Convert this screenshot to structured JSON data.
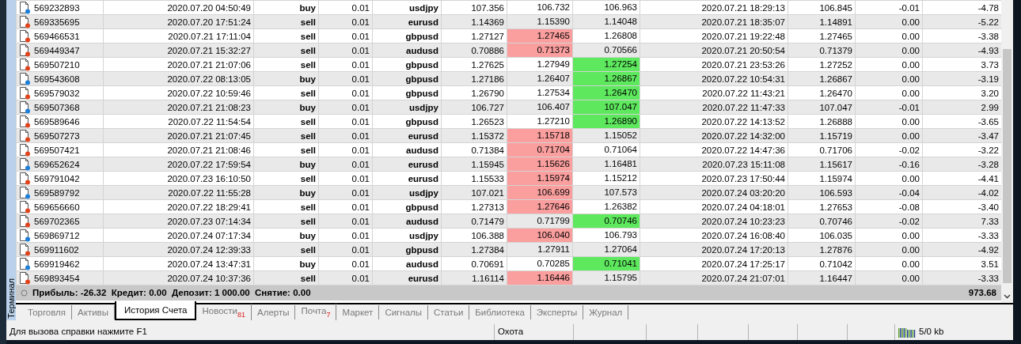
{
  "side_tab": "Терминал",
  "rows": [
    {
      "kind": "buy",
      "ticket": "569232893",
      "open_time": "2020.07.20 04:50:49",
      "type": "buy",
      "size": "0.01",
      "symbol": "usdjpy",
      "price": "107.356",
      "sl": "106.732",
      "tp": "106.963",
      "close_time": "2020.07.21 18:29:13",
      "close_price": "106.845",
      "swap": "-0.01",
      "profit": "-4.78",
      "sl_hit": false,
      "tp_hit": false
    },
    {
      "kind": "sell",
      "ticket": "569335695",
      "open_time": "2020.07.20 17:51:24",
      "type": "sell",
      "size": "0.01",
      "symbol": "eurusd",
      "price": "1.14369",
      "sl": "1.15390",
      "tp": "1.14048",
      "close_time": "2020.07.21 18:35:07",
      "close_price": "1.14891",
      "swap": "0.00",
      "profit": "-5.22",
      "sl_hit": false,
      "tp_hit": false
    },
    {
      "kind": "sell",
      "ticket": "569466531",
      "open_time": "2020.07.21 17:11:04",
      "type": "sell",
      "size": "0.01",
      "symbol": "gbpusd",
      "price": "1.27127",
      "sl": "1.27465",
      "tp": "1.26808",
      "close_time": "2020.07.21 19:22:48",
      "close_price": "1.27465",
      "swap": "0.00",
      "profit": "-3.38",
      "sl_hit": true,
      "tp_hit": false
    },
    {
      "kind": "sell",
      "ticket": "569449347",
      "open_time": "2020.07.21 15:32:27",
      "type": "sell",
      "size": "0.01",
      "symbol": "audusd",
      "price": "0.70886",
      "sl": "0.71373",
      "tp": "0.70566",
      "close_time": "2020.07.21 20:50:54",
      "close_price": "0.71379",
      "swap": "0.00",
      "profit": "-4.93",
      "sl_hit": true,
      "tp_hit": false
    },
    {
      "kind": "sell",
      "ticket": "569507210",
      "open_time": "2020.07.21 21:07:06",
      "type": "sell",
      "size": "0.01",
      "symbol": "gbpusd",
      "price": "1.27625",
      "sl": "1.27949",
      "tp": "1.27254",
      "close_time": "2020.07.21 23:53:26",
      "close_price": "1.27252",
      "swap": "0.00",
      "profit": "3.73",
      "sl_hit": false,
      "tp_hit": true
    },
    {
      "kind": "buy",
      "ticket": "569543608",
      "open_time": "2020.07.22 08:13:05",
      "type": "buy",
      "size": "0.01",
      "symbol": "gbpusd",
      "price": "1.27186",
      "sl": "1.26407",
      "tp": "1.26867",
      "close_time": "2020.07.22 10:54:31",
      "close_price": "1.26867",
      "swap": "0.00",
      "profit": "-3.19",
      "sl_hit": false,
      "tp_hit": true
    },
    {
      "kind": "sell",
      "ticket": "569579032",
      "open_time": "2020.07.22 10:59:46",
      "type": "sell",
      "size": "0.01",
      "symbol": "gbpusd",
      "price": "1.26790",
      "sl": "1.27534",
      "tp": "1.26470",
      "close_time": "2020.07.22 11:43:21",
      "close_price": "1.26470",
      "swap": "0.00",
      "profit": "3.20",
      "sl_hit": false,
      "tp_hit": true
    },
    {
      "kind": "buy",
      "ticket": "569507368",
      "open_time": "2020.07.21 21:08:23",
      "type": "buy",
      "size": "0.01",
      "symbol": "usdjpy",
      "price": "106.727",
      "sl": "106.407",
      "tp": "107.047",
      "close_time": "2020.07.22 11:47:33",
      "close_price": "107.047",
      "swap": "-0.01",
      "profit": "2.99",
      "sl_hit": false,
      "tp_hit": true
    },
    {
      "kind": "sell",
      "ticket": "569589646",
      "open_time": "2020.07.22 11:54:54",
      "type": "sell",
      "size": "0.01",
      "symbol": "gbpusd",
      "price": "1.26523",
      "sl": "1.27210",
      "tp": "1.26890",
      "close_time": "2020.07.22 14:13:52",
      "close_price": "1.26888",
      "swap": "0.00",
      "profit": "-3.65",
      "sl_hit": false,
      "tp_hit": true
    },
    {
      "kind": "sell",
      "ticket": "569507273",
      "open_time": "2020.07.21 21:07:45",
      "type": "sell",
      "size": "0.01",
      "symbol": "eurusd",
      "price": "1.15372",
      "sl": "1.15718",
      "tp": "1.15052",
      "close_time": "2020.07.22 14:32:00",
      "close_price": "1.15719",
      "swap": "0.00",
      "profit": "-3.47",
      "sl_hit": true,
      "tp_hit": false
    },
    {
      "kind": "sell",
      "ticket": "569507421",
      "open_time": "2020.07.21 21:08:46",
      "type": "sell",
      "size": "0.01",
      "symbol": "audusd",
      "price": "0.71384",
      "sl": "0.71704",
      "tp": "0.71064",
      "close_time": "2020.07.22 14:47:36",
      "close_price": "0.71706",
      "swap": "-0.02",
      "profit": "-3.22",
      "sl_hit": true,
      "tp_hit": false
    },
    {
      "kind": "buy",
      "ticket": "569652624",
      "open_time": "2020.07.22 17:59:54",
      "type": "buy",
      "size": "0.01",
      "symbol": "eurusd",
      "price": "1.15945",
      "sl": "1.15626",
      "tp": "1.16481",
      "close_time": "2020.07.23 15:11:08",
      "close_price": "1.15617",
      "swap": "-0.16",
      "profit": "-3.28",
      "sl_hit": true,
      "tp_hit": false
    },
    {
      "kind": "sell",
      "ticket": "569791042",
      "open_time": "2020.07.23 16:10:50",
      "type": "sell",
      "size": "0.01",
      "symbol": "eurusd",
      "price": "1.15533",
      "sl": "1.15974",
      "tp": "1.15212",
      "close_time": "2020.07.23 17:50:44",
      "close_price": "1.15974",
      "swap": "0.00",
      "profit": "-4.41",
      "sl_hit": true,
      "tp_hit": false
    },
    {
      "kind": "buy",
      "ticket": "569589792",
      "open_time": "2020.07.22 11:55:28",
      "type": "buy",
      "size": "0.01",
      "symbol": "usdjpy",
      "price": "107.021",
      "sl": "106.699",
      "tp": "107.573",
      "close_time": "2020.07.24 03:20:20",
      "close_price": "106.593",
      "swap": "-0.04",
      "profit": "-4.02",
      "sl_hit": true,
      "tp_hit": false
    },
    {
      "kind": "sell",
      "ticket": "569656660",
      "open_time": "2020.07.22 18:29:41",
      "type": "sell",
      "size": "0.01",
      "symbol": "gbpusd",
      "price": "1.27313",
      "sl": "1.27646",
      "tp": "1.26382",
      "close_time": "2020.07.24 04:18:01",
      "close_price": "1.27653",
      "swap": "-0.08",
      "profit": "-3.40",
      "sl_hit": true,
      "tp_hit": false
    },
    {
      "kind": "sell",
      "ticket": "569702365",
      "open_time": "2020.07.23 07:14:34",
      "type": "sell",
      "size": "0.01",
      "symbol": "audusd",
      "price": "0.71479",
      "sl": "0.71799",
      "tp": "0.70746",
      "close_time": "2020.07.24 10:23:23",
      "close_price": "0.70746",
      "swap": "-0.02",
      "profit": "7.33",
      "sl_hit": false,
      "tp_hit": true
    },
    {
      "kind": "buy",
      "ticket": "569869712",
      "open_time": "2020.07.24 07:17:34",
      "type": "buy",
      "size": "0.01",
      "symbol": "usdjpy",
      "price": "106.388",
      "sl": "106.040",
      "tp": "106.793",
      "close_time": "2020.07.24 16:08:40",
      "close_price": "106.035",
      "swap": "0.00",
      "profit": "-3.33",
      "sl_hit": true,
      "tp_hit": false
    },
    {
      "kind": "sell",
      "ticket": "569911602",
      "open_time": "2020.07.24 12:39:33",
      "type": "sell",
      "size": "0.01",
      "symbol": "gbpusd",
      "price": "1.27384",
      "sl": "1.27911",
      "tp": "1.27064",
      "close_time": "2020.07.24 17:20:13",
      "close_price": "1.27876",
      "swap": "0.00",
      "profit": "-4.92",
      "sl_hit": false,
      "tp_hit": false
    },
    {
      "kind": "buy",
      "ticket": "569919462",
      "open_time": "2020.07.24 13:47:31",
      "type": "buy",
      "size": "0.01",
      "symbol": "audusd",
      "price": "0.70691",
      "sl": "0.70285",
      "tp": "0.71041",
      "close_time": "2020.07.24 17:25:17",
      "close_price": "0.71042",
      "swap": "0.00",
      "profit": "3.51",
      "sl_hit": false,
      "tp_hit": true
    },
    {
      "kind": "sell",
      "ticket": "569893454",
      "open_time": "2020.07.24 10:37:36",
      "type": "sell",
      "size": "0.01",
      "symbol": "eurusd",
      "price": "1.16114",
      "sl": "1.16446",
      "tp": "1.15795",
      "close_time": "2020.07.24 21:07:01",
      "close_price": "1.16447",
      "swap": "0.00",
      "profit": "-3.33",
      "sl_hit": true,
      "tp_hit": false
    }
  ],
  "summary": {
    "text": "Прибыль: -26.32  Кредит: 0.00  Депозит: 1 000.00  Снятие: 0.00",
    "total": "973.68"
  },
  "tabs": [
    {
      "label": "Торговля",
      "selected": false
    },
    {
      "label": "Активы",
      "selected": false
    },
    {
      "label": "История Счета",
      "selected": true
    },
    {
      "label": "Новости",
      "badge": "81",
      "selected": false
    },
    {
      "label": "Алерты",
      "selected": false
    },
    {
      "label": "Почта",
      "badge": "7",
      "selected": false
    },
    {
      "label": "Маркет",
      "selected": false
    },
    {
      "label": "Сигналы",
      "selected": false
    },
    {
      "label": "Статьи",
      "selected": false
    },
    {
      "label": "Библиотека",
      "selected": false
    },
    {
      "label": "Эксперты",
      "selected": false
    },
    {
      "label": "Журнал",
      "selected": false
    }
  ],
  "status_bar": {
    "help": "Для вызова справки нажмите F1",
    "profile": "Охота",
    "traffic": "5/0 kb"
  }
}
